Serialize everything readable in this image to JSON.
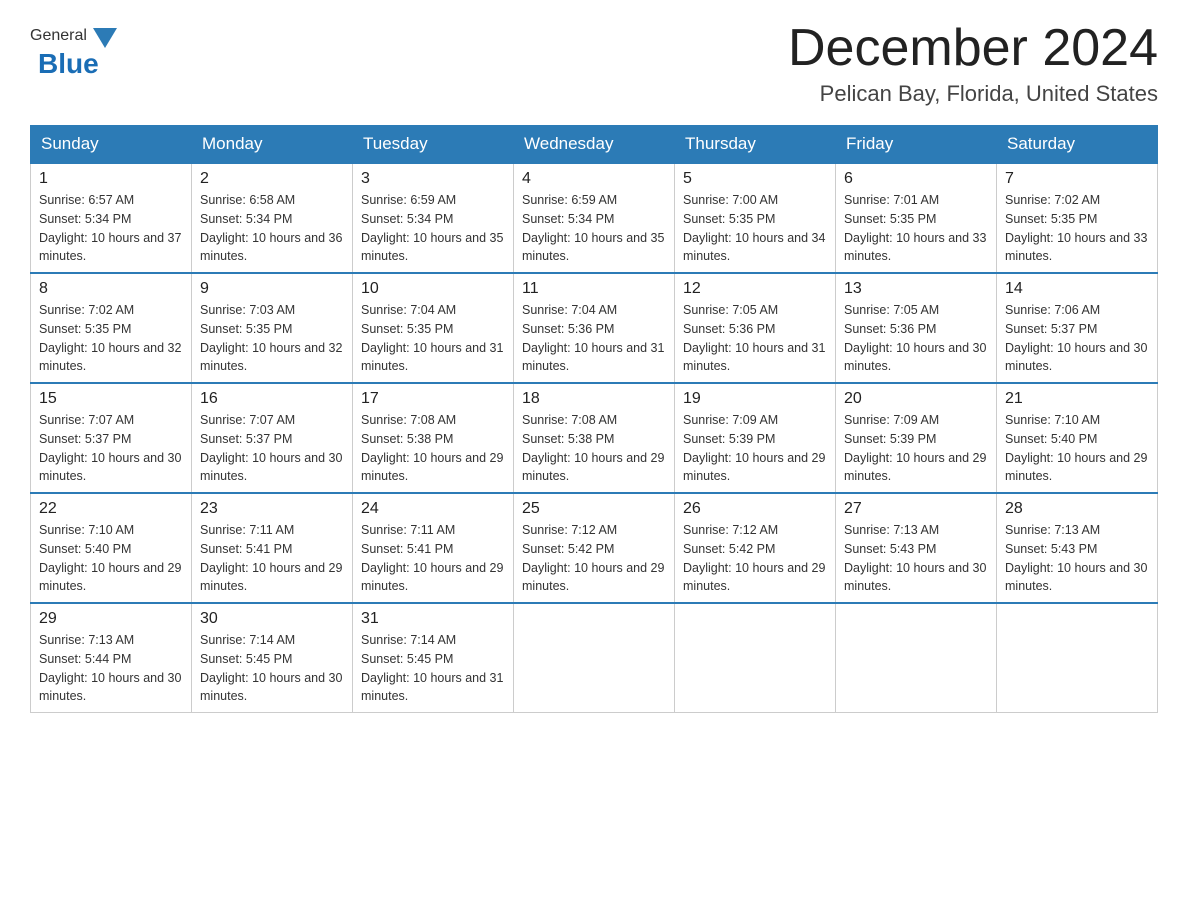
{
  "header": {
    "logo": {
      "part1": "General",
      "part2": "Blue"
    },
    "title": "December 2024",
    "subtitle": "Pelican Bay, Florida, United States"
  },
  "weekdays": [
    "Sunday",
    "Monday",
    "Tuesday",
    "Wednesday",
    "Thursday",
    "Friday",
    "Saturday"
  ],
  "weeks": [
    [
      {
        "day": "1",
        "sunrise": "6:57 AM",
        "sunset": "5:34 PM",
        "daylight": "10 hours and 37 minutes."
      },
      {
        "day": "2",
        "sunrise": "6:58 AM",
        "sunset": "5:34 PM",
        "daylight": "10 hours and 36 minutes."
      },
      {
        "day": "3",
        "sunrise": "6:59 AM",
        "sunset": "5:34 PM",
        "daylight": "10 hours and 35 minutes."
      },
      {
        "day": "4",
        "sunrise": "6:59 AM",
        "sunset": "5:34 PM",
        "daylight": "10 hours and 35 minutes."
      },
      {
        "day": "5",
        "sunrise": "7:00 AM",
        "sunset": "5:35 PM",
        "daylight": "10 hours and 34 minutes."
      },
      {
        "day": "6",
        "sunrise": "7:01 AM",
        "sunset": "5:35 PM",
        "daylight": "10 hours and 33 minutes."
      },
      {
        "day": "7",
        "sunrise": "7:02 AM",
        "sunset": "5:35 PM",
        "daylight": "10 hours and 33 minutes."
      }
    ],
    [
      {
        "day": "8",
        "sunrise": "7:02 AM",
        "sunset": "5:35 PM",
        "daylight": "10 hours and 32 minutes."
      },
      {
        "day": "9",
        "sunrise": "7:03 AM",
        "sunset": "5:35 PM",
        "daylight": "10 hours and 32 minutes."
      },
      {
        "day": "10",
        "sunrise": "7:04 AM",
        "sunset": "5:35 PM",
        "daylight": "10 hours and 31 minutes."
      },
      {
        "day": "11",
        "sunrise": "7:04 AM",
        "sunset": "5:36 PM",
        "daylight": "10 hours and 31 minutes."
      },
      {
        "day": "12",
        "sunrise": "7:05 AM",
        "sunset": "5:36 PM",
        "daylight": "10 hours and 31 minutes."
      },
      {
        "day": "13",
        "sunrise": "7:05 AM",
        "sunset": "5:36 PM",
        "daylight": "10 hours and 30 minutes."
      },
      {
        "day": "14",
        "sunrise": "7:06 AM",
        "sunset": "5:37 PM",
        "daylight": "10 hours and 30 minutes."
      }
    ],
    [
      {
        "day": "15",
        "sunrise": "7:07 AM",
        "sunset": "5:37 PM",
        "daylight": "10 hours and 30 minutes."
      },
      {
        "day": "16",
        "sunrise": "7:07 AM",
        "sunset": "5:37 PM",
        "daylight": "10 hours and 30 minutes."
      },
      {
        "day": "17",
        "sunrise": "7:08 AM",
        "sunset": "5:38 PM",
        "daylight": "10 hours and 29 minutes."
      },
      {
        "day": "18",
        "sunrise": "7:08 AM",
        "sunset": "5:38 PM",
        "daylight": "10 hours and 29 minutes."
      },
      {
        "day": "19",
        "sunrise": "7:09 AM",
        "sunset": "5:39 PM",
        "daylight": "10 hours and 29 minutes."
      },
      {
        "day": "20",
        "sunrise": "7:09 AM",
        "sunset": "5:39 PM",
        "daylight": "10 hours and 29 minutes."
      },
      {
        "day": "21",
        "sunrise": "7:10 AM",
        "sunset": "5:40 PM",
        "daylight": "10 hours and 29 minutes."
      }
    ],
    [
      {
        "day": "22",
        "sunrise": "7:10 AM",
        "sunset": "5:40 PM",
        "daylight": "10 hours and 29 minutes."
      },
      {
        "day": "23",
        "sunrise": "7:11 AM",
        "sunset": "5:41 PM",
        "daylight": "10 hours and 29 minutes."
      },
      {
        "day": "24",
        "sunrise": "7:11 AM",
        "sunset": "5:41 PM",
        "daylight": "10 hours and 29 minutes."
      },
      {
        "day": "25",
        "sunrise": "7:12 AM",
        "sunset": "5:42 PM",
        "daylight": "10 hours and 29 minutes."
      },
      {
        "day": "26",
        "sunrise": "7:12 AM",
        "sunset": "5:42 PM",
        "daylight": "10 hours and 29 minutes."
      },
      {
        "day": "27",
        "sunrise": "7:13 AM",
        "sunset": "5:43 PM",
        "daylight": "10 hours and 30 minutes."
      },
      {
        "day": "28",
        "sunrise": "7:13 AM",
        "sunset": "5:43 PM",
        "daylight": "10 hours and 30 minutes."
      }
    ],
    [
      {
        "day": "29",
        "sunrise": "7:13 AM",
        "sunset": "5:44 PM",
        "daylight": "10 hours and 30 minutes."
      },
      {
        "day": "30",
        "sunrise": "7:14 AM",
        "sunset": "5:45 PM",
        "daylight": "10 hours and 30 minutes."
      },
      {
        "day": "31",
        "sunrise": "7:14 AM",
        "sunset": "5:45 PM",
        "daylight": "10 hours and 31 minutes."
      },
      null,
      null,
      null,
      null
    ]
  ]
}
